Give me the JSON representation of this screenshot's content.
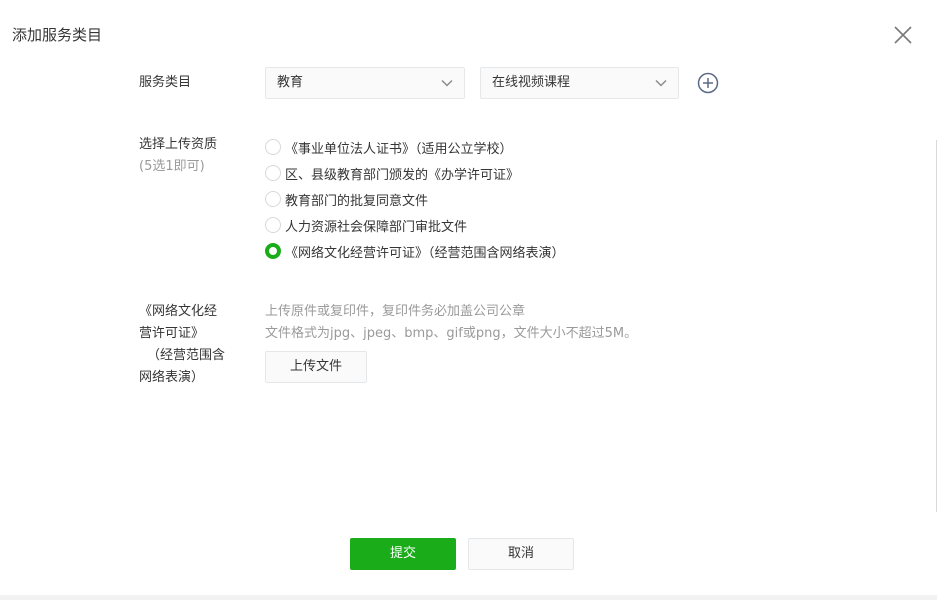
{
  "dialog": {
    "title": "添加服务类目",
    "close_icon": "close-icon"
  },
  "category": {
    "label": "服务类目",
    "primary_select": "教育",
    "secondary_select": "在线视频课程",
    "add_icon": "plus-circle-icon"
  },
  "qualification": {
    "label": "选择上传资质",
    "sub_label": "(5选1即可)",
    "options": [
      {
        "label": "《事业单位法人证书》（适用公立学校）",
        "checked": false
      },
      {
        "label": "区、县级教育部门颁发的《办学许可证》",
        "checked": false
      },
      {
        "label": "教育部门的批复同意文件",
        "checked": false
      },
      {
        "label": "人力资源社会保障部门审批文件",
        "checked": false
      },
      {
        "label": "《网络文化经营许可证》（经营范围含网络表演）",
        "checked": true
      }
    ]
  },
  "upload": {
    "label_lines": [
      "《网络文化经",
      "营许可证》",
      "（经营范围含",
      "网络表演）"
    ],
    "tip_line1": "上传原件或复印件，复印件务必加盖公司公章",
    "tip_line2": "文件格式为jpg、jpeg、bmp、gif或png，文件大小不超过5M。",
    "button_label": "上传文件"
  },
  "footer": {
    "submit_label": "提交",
    "cancel_label": "取消"
  },
  "colors": {
    "accent": "#1aad19",
    "muted_text": "#9a9a9a",
    "border": "#e4e8eb"
  }
}
